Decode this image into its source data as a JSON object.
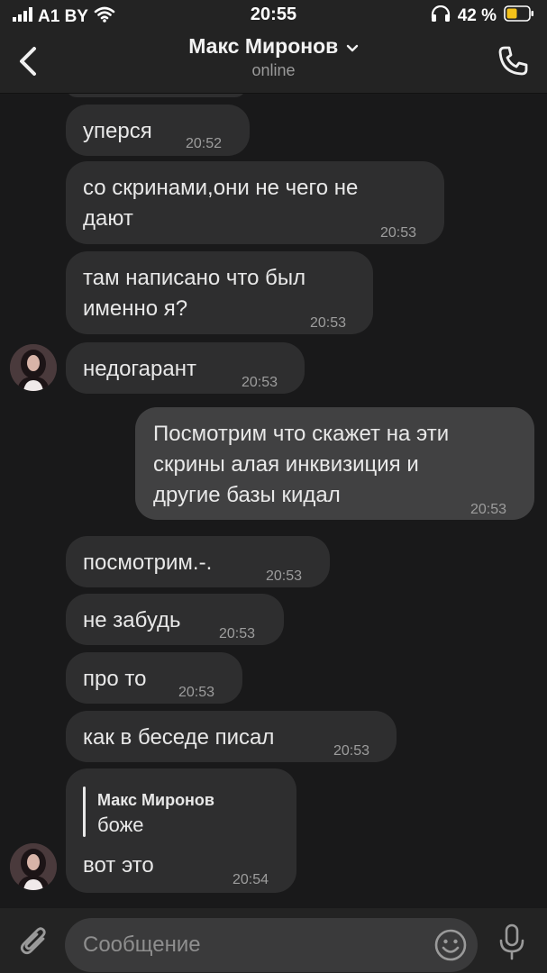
{
  "status_bar": {
    "carrier": "A1 BY",
    "time": "20:55",
    "battery": "42 %",
    "icons": [
      "signal-icon",
      "wifi-icon",
      "headphones-icon",
      "battery-icon"
    ]
  },
  "header": {
    "back_icon": "chevron-left-icon",
    "contact_name": "Макс Миронов",
    "status": "online",
    "call_icon": "phone-icon"
  },
  "messages": [
    {
      "dir": "in",
      "text": "уперся",
      "time": "20:52"
    },
    {
      "dir": "in",
      "text_lines": [
        "со скринами,они не чего не",
        "дают"
      ],
      "time": "20:53"
    },
    {
      "dir": "in",
      "text_lines": [
        "там написано что был",
        "именно я?"
      ],
      "time": "20:53"
    },
    {
      "dir": "in",
      "text": "недогарант",
      "time": "20:53",
      "avatar": true
    },
    {
      "dir": "out",
      "text_lines": [
        "Посмотрим что скажет на эти",
        "скрины алая инквизиция и",
        "другие базы кидал"
      ],
      "time": "20:53"
    },
    {
      "dir": "in",
      "text": "посмотрим.-.",
      "time": "20:53"
    },
    {
      "dir": "in",
      "text": "не забудь",
      "time": "20:53"
    },
    {
      "dir": "in",
      "text": "про то",
      "time": "20:53"
    },
    {
      "dir": "in",
      "text": "как в беседе писал",
      "time": "20:53"
    },
    {
      "dir": "in",
      "reply": {
        "name": "Макс Миронов",
        "text": "боже"
      },
      "text": "вот это",
      "time": "20:54",
      "avatar": true
    }
  ],
  "composer": {
    "placeholder": "Сообщение",
    "attach_icon": "paperclip-icon",
    "emoji_icon": "emoji-icon",
    "mic_icon": "microphone-icon"
  },
  "colors": {
    "background": "#19191a",
    "bar": "#232323",
    "bubble_in": "#2e2e2f",
    "bubble_out": "#414142",
    "text": "#e8e8e8",
    "time": "#9d9d9d",
    "battery_fill": "#f4c21a"
  }
}
